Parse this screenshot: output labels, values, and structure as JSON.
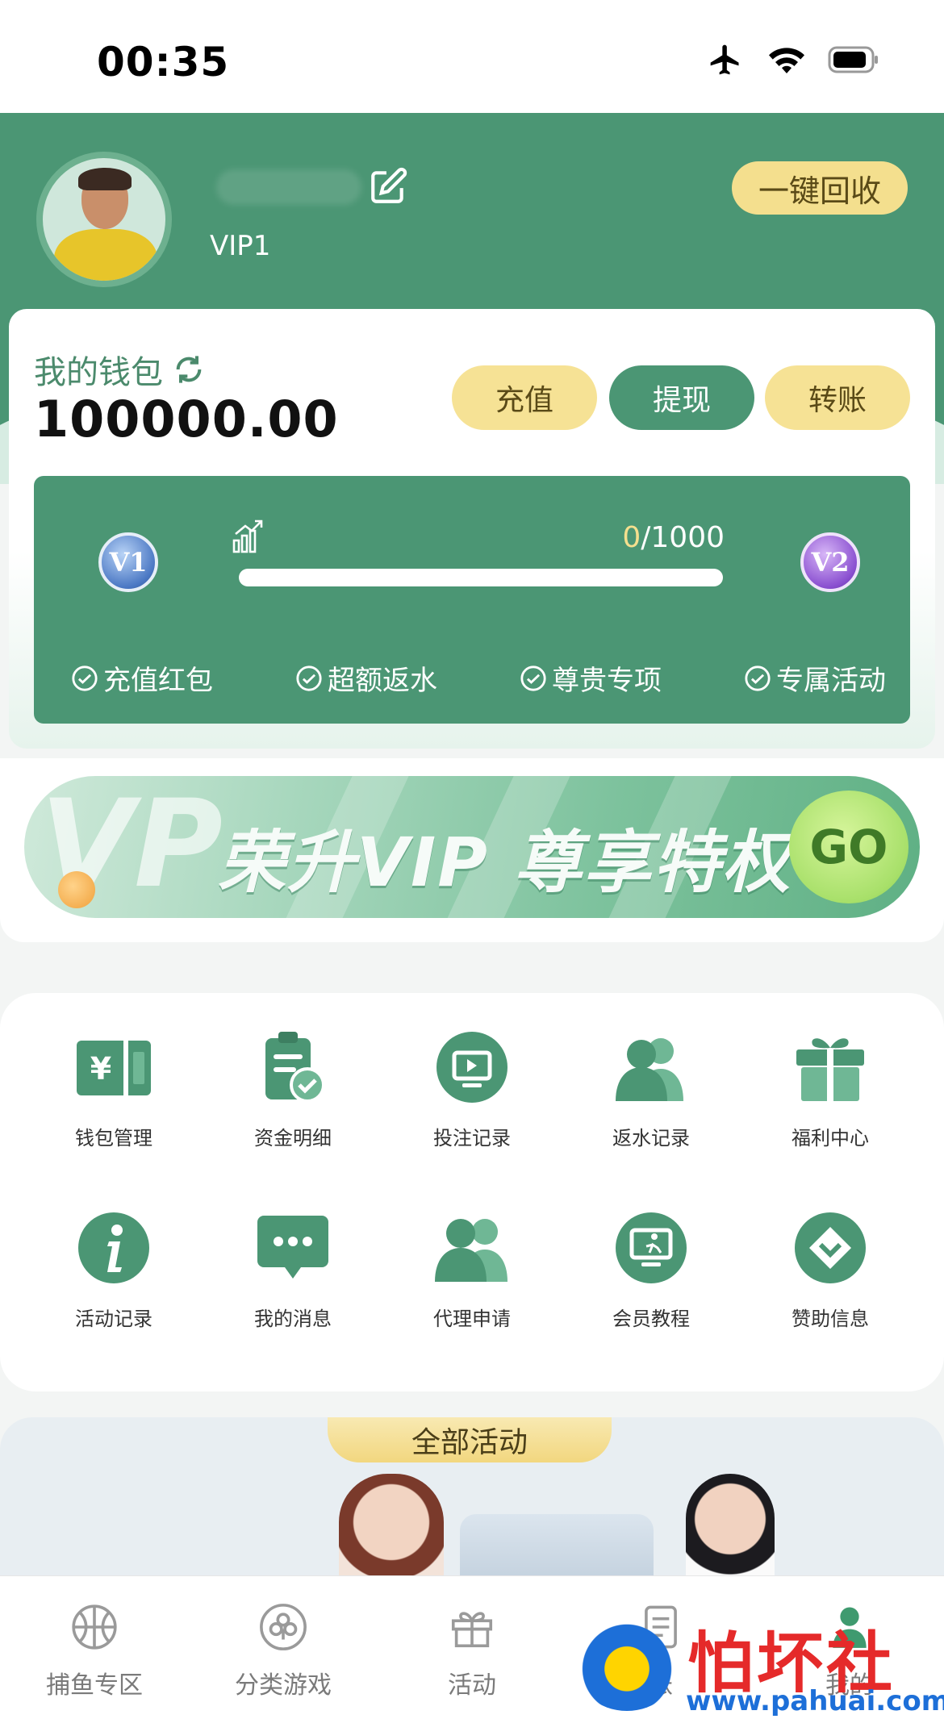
{
  "status_bar": {
    "time": "00:35"
  },
  "profile": {
    "vip_level": "VIP1",
    "recycle_label": "一键回收"
  },
  "wallet": {
    "title": "我的钱包",
    "balance": "100000.00",
    "buttons": {
      "recharge": "充值",
      "withdraw": "提现",
      "transfer": "转账"
    },
    "vip_progress": {
      "current_badge": "V1",
      "next_badge": "V2",
      "current": "0",
      "target": "/1000",
      "progress_fraction": 0
    },
    "perks": [
      "充值红包",
      "超额返水",
      "尊贵专项",
      "专属活动"
    ]
  },
  "banner": {
    "title": "荣升VIP 尊享特权",
    "go_label": "GO"
  },
  "menu": {
    "items": [
      {
        "label": "钱包管理",
        "icon": "wallet-yen-icon"
      },
      {
        "label": "资金明细",
        "icon": "clipboard-check-icon"
      },
      {
        "label": "投注记录",
        "icon": "tv-record-icon"
      },
      {
        "label": "返水记录",
        "icon": "users-icon"
      },
      {
        "label": "福利中心",
        "icon": "gift-icon"
      },
      {
        "label": "活动记录",
        "icon": "info-icon"
      },
      {
        "label": "我的消息",
        "icon": "message-icon"
      },
      {
        "label": "代理申请",
        "icon": "agent-icon"
      },
      {
        "label": "会员教程",
        "icon": "tutorial-monitor-icon"
      },
      {
        "label": "赞助信息",
        "icon": "sponsor-diamond-icon"
      }
    ]
  },
  "activities": {
    "title": "全部活动"
  },
  "tabbar": {
    "tabs": [
      {
        "label": "捕鱼专区",
        "icon": "basketball-icon"
      },
      {
        "label": "分类游戏",
        "icon": "club-icon"
      },
      {
        "label": "活动",
        "icon": "gift-icon"
      },
      {
        "label": "账",
        "icon": "document-icon"
      },
      {
        "label": "我的",
        "icon": "person-icon"
      }
    ]
  },
  "watermark": {
    "text": "怕坏社区",
    "url": "www.pahuai.com"
  },
  "colors": {
    "primary_green": "#4b9674",
    "gold": "#f4df8e",
    "background": "#f3f5f4"
  }
}
